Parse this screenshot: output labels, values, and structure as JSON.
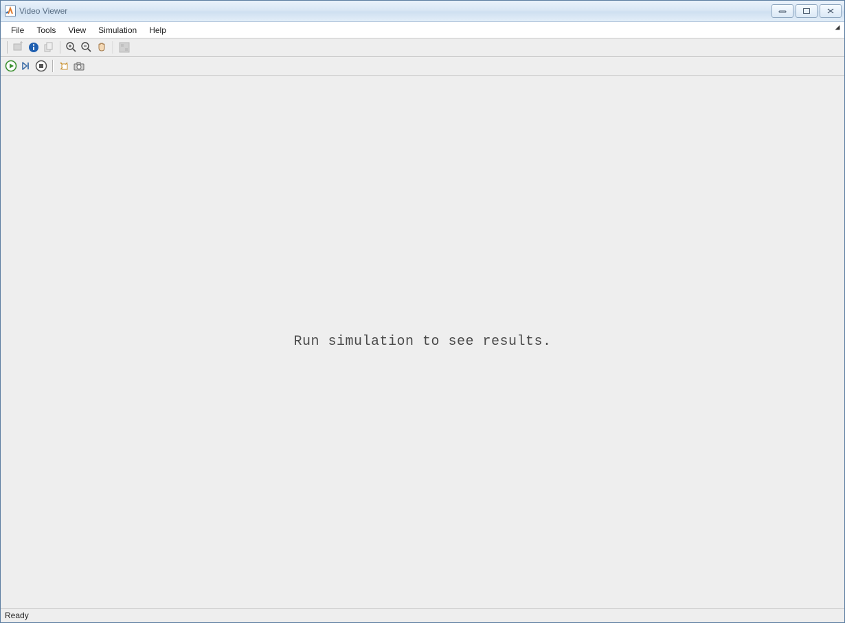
{
  "window": {
    "title": "Video Viewer"
  },
  "menu": {
    "items": [
      "File",
      "Tools",
      "View",
      "Simulation",
      "Help"
    ]
  },
  "toolbar1": {
    "icons": {
      "new_scope": "new-scope-icon",
      "info": "info-icon",
      "copy": "copy-icon",
      "zoom_in": "zoom-in-icon",
      "zoom_out": "zoom-out-icon",
      "pan": "pan-hand-icon",
      "colormap": "colormap-icon"
    }
  },
  "toolbar2": {
    "icons": {
      "play": "play-icon",
      "step": "step-forward-icon",
      "stop": "stop-icon",
      "highlight": "highlight-block-icon",
      "snapshot": "snapshot-camera-icon"
    }
  },
  "viewer": {
    "placeholder": "Run simulation to see results."
  },
  "status": {
    "text": "Ready"
  }
}
